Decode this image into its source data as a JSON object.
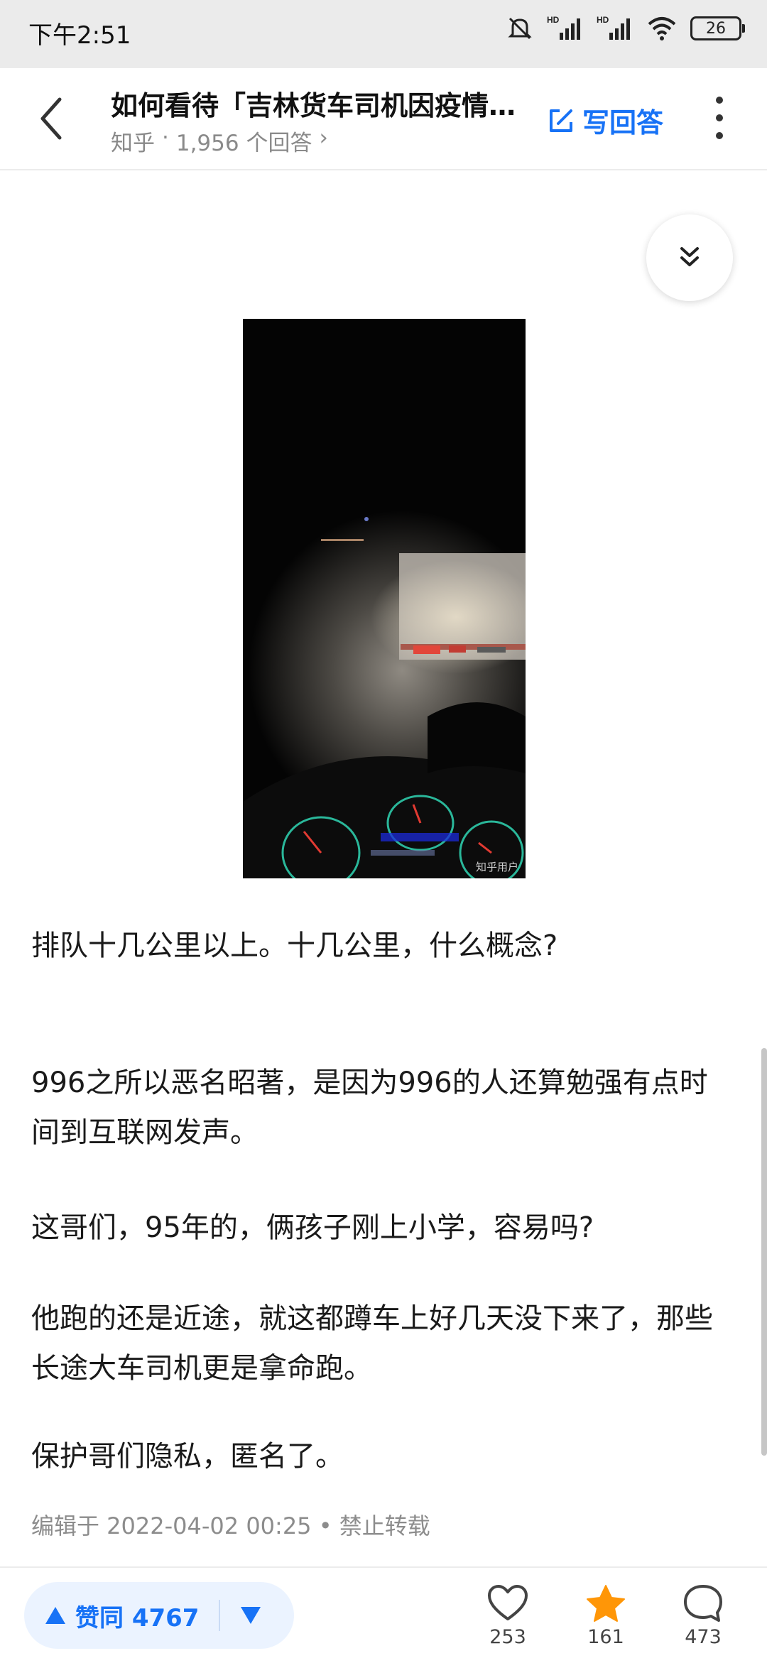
{
  "status_bar": {
    "time": "下午2:51",
    "signal_label_1": "HD",
    "signal_label_2": "HD",
    "battery": "26"
  },
  "header": {
    "title": "如何看待「吉林货车司机因疫情受困...",
    "site": "知乎",
    "separator": "·",
    "answer_count": "1,956 个回答",
    "chevron": "›",
    "write_answer_label": "写回答"
  },
  "video": {
    "watermark": "知乎用户"
  },
  "article": {
    "paragraphs": [
      "排队十几公里以上。十几公里，什么概念?",
      "996之所以恶名昭著，是因为996的人还算勉强有点时间到互联网发声。",
      "这哥们，95年的，俩孩子刚上小学，容易吗?",
      "他跑的还是近途，就这都蹲车上好几天没下来了，那些长途大车司机更是拿命跑。",
      "保护哥们隐私，匿名了。"
    ],
    "meta": "编辑于 2022-04-02 00:25 • 禁止转载"
  },
  "bottom_bar": {
    "upvote_label": "赞同 4767",
    "like_count": "253",
    "favorite_count": "161",
    "comment_count": "473"
  },
  "colors": {
    "accent": "#1772f6",
    "favorite": "#ff9607",
    "status_bar_bg": "#ebebeb"
  }
}
